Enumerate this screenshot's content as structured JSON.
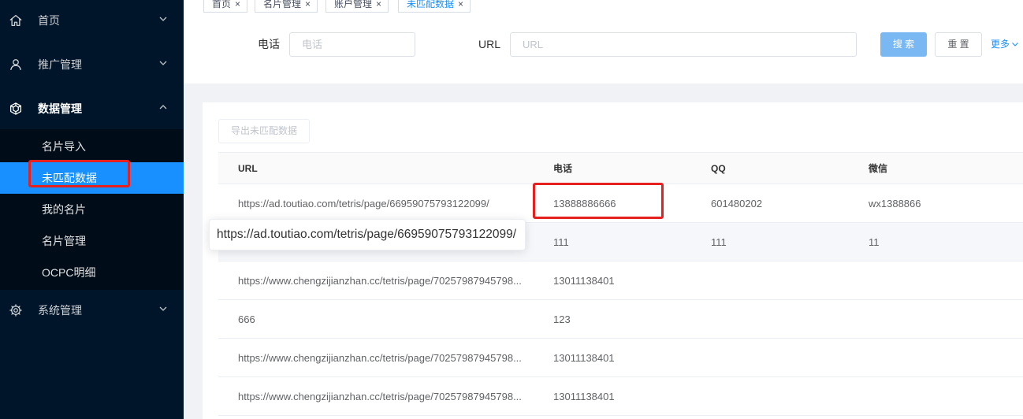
{
  "tabs": [
    {
      "label": "首页",
      "close": "×",
      "active": false
    },
    {
      "label": "名片管理",
      "close": "×",
      "active": false
    },
    {
      "label": "账户管理",
      "close": "×",
      "active": false
    },
    {
      "label": "未匹配数据",
      "close": "×",
      "active": true
    }
  ],
  "sidebar": {
    "items": [
      {
        "label": "首页",
        "icon": "home-icon",
        "chevron": "chevron-down-icon"
      },
      {
        "label": "推广管理",
        "icon": "user-icon",
        "chevron": "chevron-down-icon"
      },
      {
        "label": "数据管理",
        "icon": "cube-icon",
        "chevron": "chevron-up-icon",
        "expanded": true,
        "children": [
          {
            "label": "名片导入",
            "selected": false
          },
          {
            "label": "未匹配数据",
            "selected": true
          },
          {
            "label": "我的名片",
            "selected": false
          },
          {
            "label": "名片管理",
            "selected": false
          },
          {
            "label": "OCPC明细",
            "selected": false
          }
        ]
      },
      {
        "label": "系统管理",
        "icon": "gear-icon",
        "chevron": "chevron-down-icon"
      }
    ]
  },
  "search": {
    "phone": {
      "label": "电话",
      "value": "",
      "placeholder": "电话"
    },
    "url": {
      "label": "URL",
      "value": "",
      "placeholder": "URL"
    },
    "search_label": "搜 索",
    "reset_label": "重 置",
    "more_label": "更多"
  },
  "toolbar": {
    "export_label": "导出未匹配数据",
    "export_disabled": true
  },
  "table": {
    "columns": [
      "URL",
      "电话",
      "QQ",
      "微信"
    ],
    "rows": [
      {
        "url": "https://ad.toutiao.com/tetris/page/66959075793122099/",
        "phone": "13888886666",
        "qq": "601480202",
        "wechat": "wx1388866"
      },
      {
        "url": "",
        "phone": "111",
        "qq": "111",
        "wechat": "11"
      },
      {
        "url": "https://www.chengzijianzhan.cc/tetris/page/70257987945798...",
        "phone": "13011138401",
        "qq": "",
        "wechat": ""
      },
      {
        "url": "666",
        "phone": "123",
        "qq": "",
        "wechat": ""
      },
      {
        "url": "https://www.chengzijianzhan.cc/tetris/page/70257987945798...",
        "phone": "13011138401",
        "qq": "",
        "wechat": ""
      },
      {
        "url": "https://www.chengzijianzhan.cc/tetris/page/70257987945798...",
        "phone": "13011138401",
        "qq": "",
        "wechat": ""
      }
    ]
  },
  "tooltip": {
    "text": "https://ad.toutiao.com/tetris/page/66959075793122099/"
  },
  "colors": {
    "accent": "#1890ff",
    "sidebar_bg": "#001529",
    "submenu_bg": "#000c17",
    "search_button": "#79b8f3",
    "annotation": "#e5201f"
  }
}
